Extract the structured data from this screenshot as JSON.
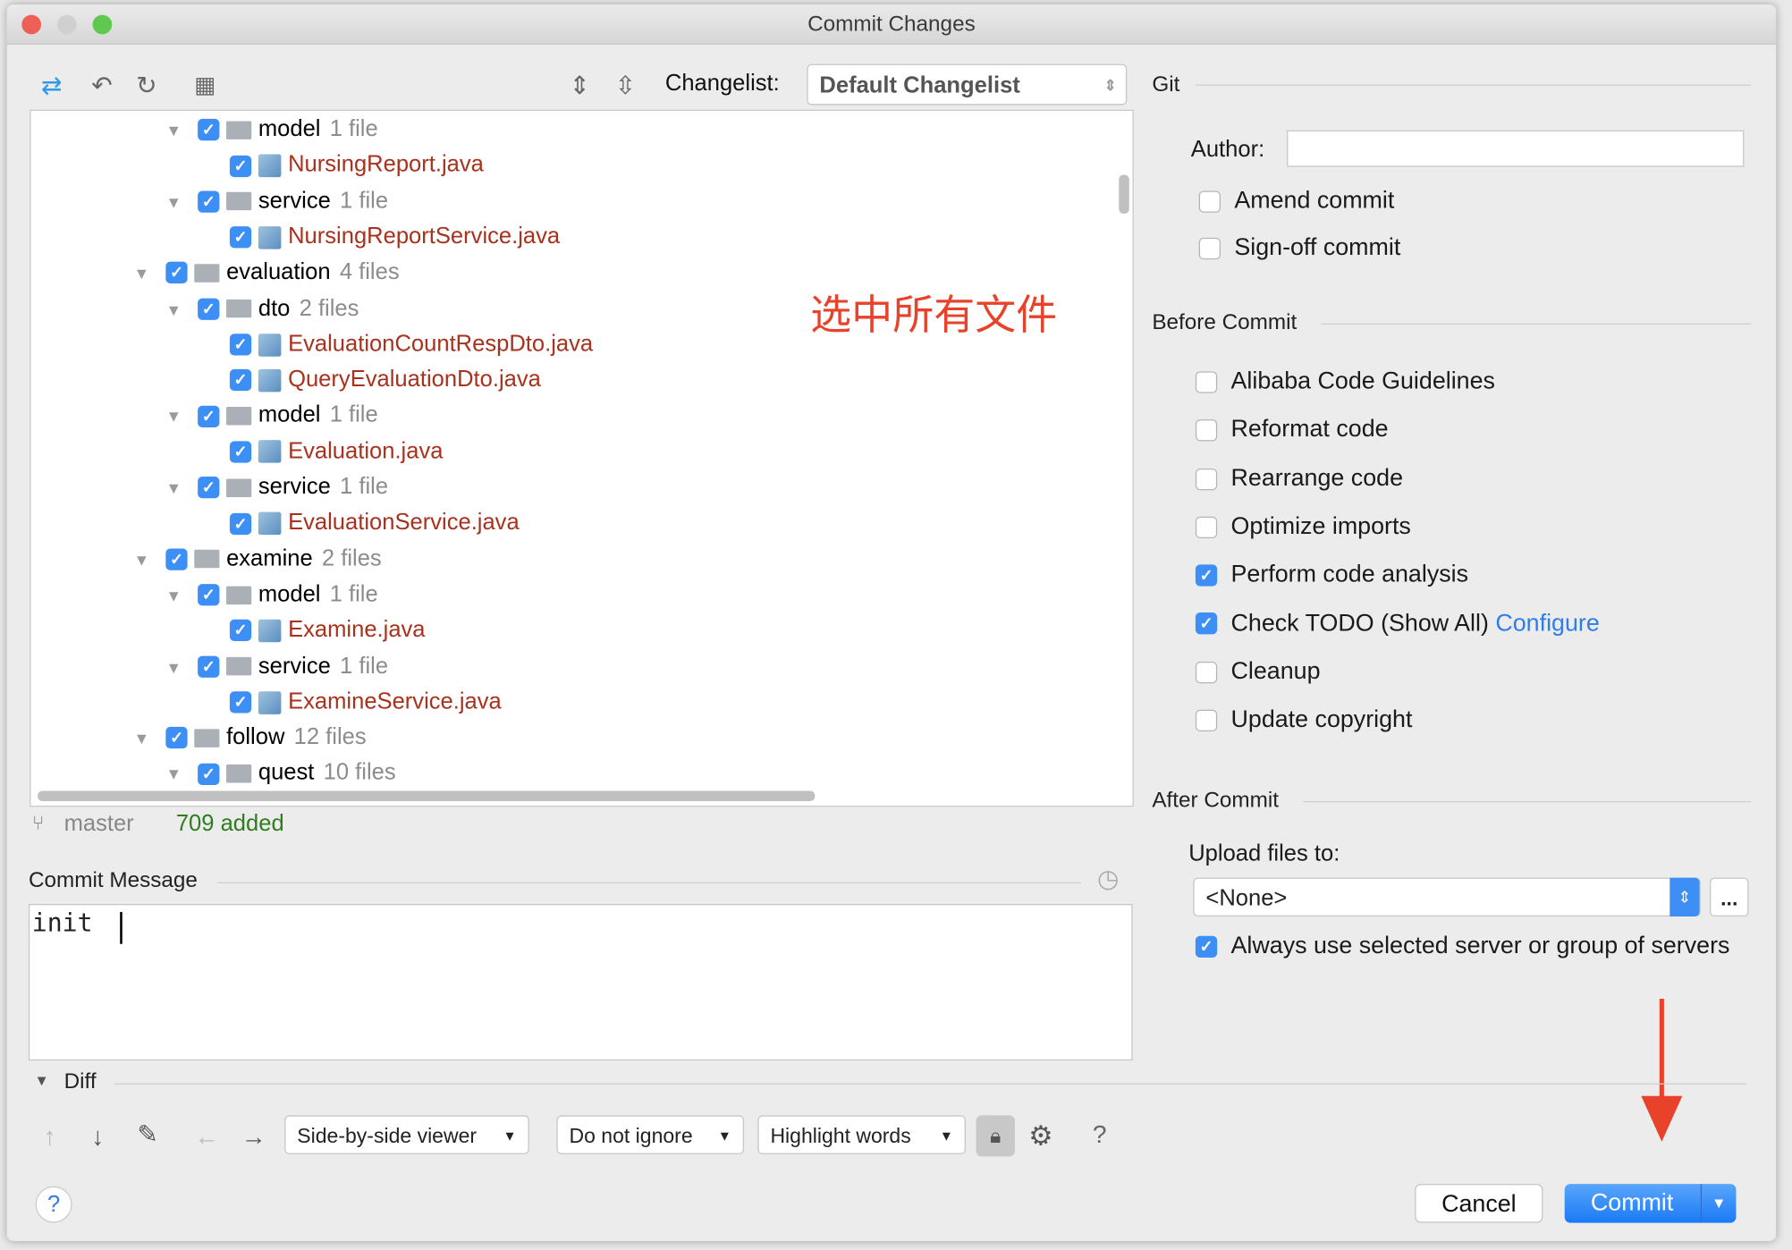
{
  "window": {
    "title": "Commit Changes"
  },
  "toolbar": {
    "changelist_label": "Changelist:",
    "changelist_value": "Default Changelist"
  },
  "tree": [
    {
      "level": 2,
      "type": "folder",
      "name": "model",
      "count": "1 file"
    },
    {
      "level": 3,
      "type": "file",
      "name": "NursingReport.java"
    },
    {
      "level": 2,
      "type": "folder",
      "name": "service",
      "count": "1 file"
    },
    {
      "level": 3,
      "type": "file",
      "name": "NursingReportService.java"
    },
    {
      "level": 1,
      "type": "folder",
      "name": "evaluation",
      "count": "4 files"
    },
    {
      "level": 2,
      "type": "folder",
      "name": "dto",
      "count": "2 files"
    },
    {
      "level": 3,
      "type": "file",
      "name": "EvaluationCountRespDto.java"
    },
    {
      "level": 3,
      "type": "file",
      "name": "QueryEvaluationDto.java"
    },
    {
      "level": 2,
      "type": "folder",
      "name": "model",
      "count": "1 file"
    },
    {
      "level": 3,
      "type": "file",
      "name": "Evaluation.java"
    },
    {
      "level": 2,
      "type": "folder",
      "name": "service",
      "count": "1 file"
    },
    {
      "level": 3,
      "type": "file",
      "name": "EvaluationService.java"
    },
    {
      "level": 1,
      "type": "folder",
      "name": "examine",
      "count": "2 files"
    },
    {
      "level": 2,
      "type": "folder",
      "name": "model",
      "count": "1 file"
    },
    {
      "level": 3,
      "type": "file",
      "name": "Examine.java"
    },
    {
      "level": 2,
      "type": "folder",
      "name": "service",
      "count": "1 file"
    },
    {
      "level": 3,
      "type": "file",
      "name": "ExamineService.java"
    },
    {
      "level": 1,
      "type": "folder",
      "name": "follow",
      "count": "12 files"
    },
    {
      "level": 2,
      "type": "folder",
      "name": "quest",
      "count": "10 files"
    }
  ],
  "annotation": "选中所有文件",
  "status": {
    "branch": "master",
    "added": "709 added"
  },
  "commit_message": {
    "label": "Commit Message",
    "value": "init "
  },
  "git": {
    "section": "Git",
    "author_label": "Author:",
    "author_value": "",
    "options": [
      {
        "label": "Amend commit",
        "checked": false
      },
      {
        "label": "Sign-off commit",
        "checked": false
      }
    ]
  },
  "before_commit": {
    "section": "Before Commit",
    "options": [
      {
        "label": "Alibaba Code Guidelines",
        "checked": false
      },
      {
        "label": "Reformat code",
        "checked": false
      },
      {
        "label": "Rearrange code",
        "checked": false
      },
      {
        "label": "Optimize imports",
        "checked": false
      },
      {
        "label": "Perform code analysis",
        "checked": true
      },
      {
        "label": "Check TODO (Show All)",
        "checked": true,
        "link": "Configure"
      },
      {
        "label": "Cleanup",
        "checked": false
      },
      {
        "label": "Update copyright",
        "checked": false
      }
    ]
  },
  "after_commit": {
    "section": "After Commit",
    "upload_label": "Upload files to:",
    "upload_value": "<None>",
    "browse_label": "...",
    "always_label": "Always use selected server or group of servers",
    "always_checked": true
  },
  "diff": {
    "label": "Diff",
    "viewer": "Side-by-side viewer",
    "ignore": "Do not ignore",
    "highlight": "Highlight words",
    "help": "?"
  },
  "buttons": {
    "cancel": "Cancel",
    "commit": "Commit",
    "help": "?"
  },
  "colors": {
    "accent": "#3d8ff6",
    "file_modified": "#a8321d",
    "added": "#2e7d1e",
    "annotation": "#e8432a"
  }
}
